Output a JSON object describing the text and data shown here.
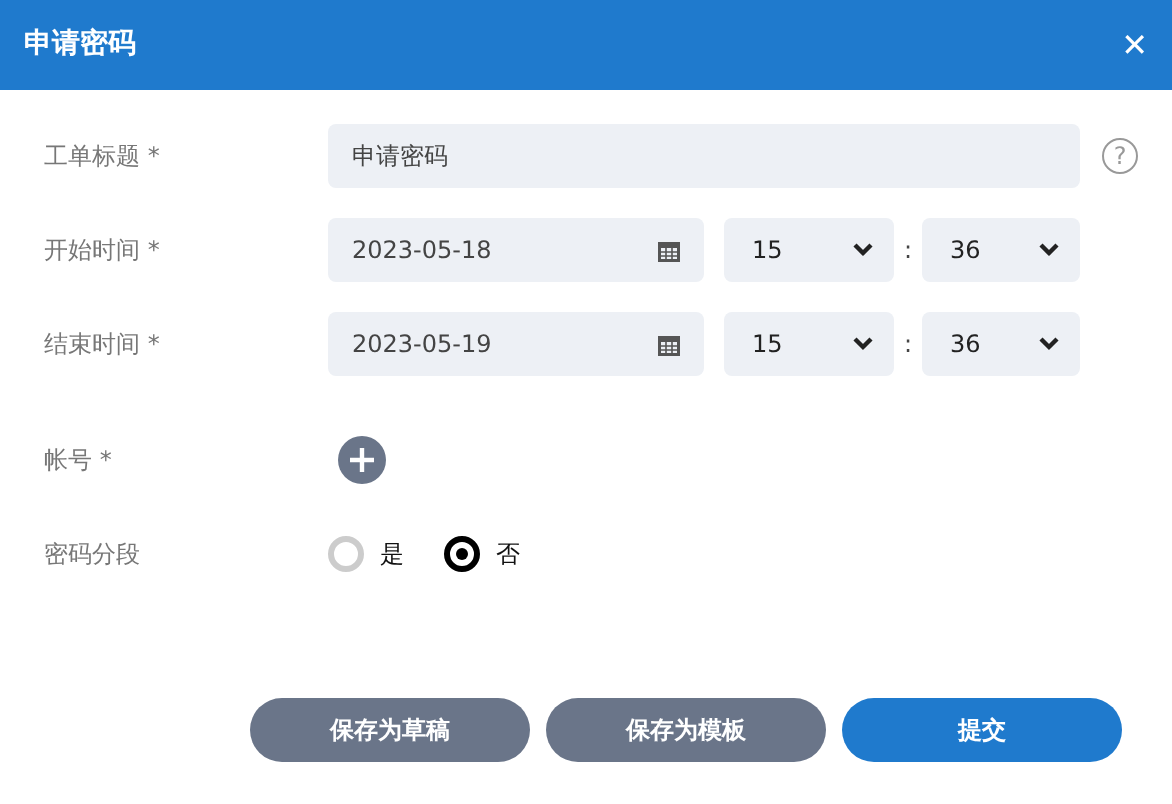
{
  "window": {
    "title": "申请密码",
    "close": "✕"
  },
  "fields": [
    {
      "kind": "text",
      "label": "工单标题 *",
      "value": "申请密码",
      "help": "?"
    },
    {
      "kind": "datetime",
      "label": "开始时间 *",
      "date": "2023-05-18",
      "hour": "15",
      "separator": ":",
      "minute": "36"
    },
    {
      "kind": "datetime",
      "label": "结束时间 *",
      "date": "2023-05-19",
      "hour": "15",
      "separator": ":",
      "minute": "36"
    },
    {
      "kind": "add",
      "label": "帐号 *"
    },
    {
      "kind": "radio",
      "label": "密码分段",
      "options": [
        {
          "label": "是",
          "selected": false
        },
        {
          "label": "否",
          "selected": true
        }
      ]
    }
  ],
  "buttons": [
    {
      "label": "保存为草稿",
      "kind": "secondary"
    },
    {
      "label": "保存为模板",
      "kind": "secondary"
    },
    {
      "label": "提交",
      "kind": "primary"
    }
  ]
}
